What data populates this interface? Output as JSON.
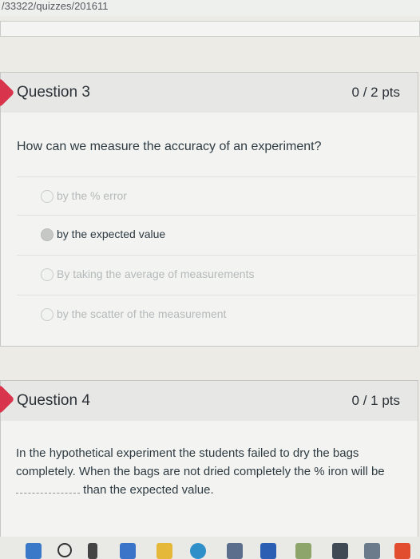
{
  "url": "/33322/quizzes/201611",
  "question3": {
    "title": "Question 3",
    "points": "0 / 2 pts",
    "prompt": "How can we measure the accuracy of an experiment?",
    "answers": [
      {
        "label": "by the % error",
        "selected": false
      },
      {
        "label": "by the expected value",
        "selected": true
      },
      {
        "label": "By taking the average of measurements",
        "selected": false
      },
      {
        "label": "by the scatter of the measurement",
        "selected": false
      }
    ]
  },
  "question4": {
    "title": "Question 4",
    "points": "0 / 1 pts",
    "text_part1": "In the hypothetical experiment the students failed to dry the bags completely. When the bags are not dried completely the % iron will be",
    "text_part2": "than the expected value."
  },
  "colors": {
    "marker": "#d8344c"
  },
  "taskbar_icons": [
    "windows-icon",
    "search-icon",
    "task-view-icon",
    "widgets-icon",
    "file-explorer-icon",
    "edge-icon",
    "store-icon",
    "mail-icon",
    "photos-icon",
    "calendar-icon",
    "app-icon"
  ]
}
